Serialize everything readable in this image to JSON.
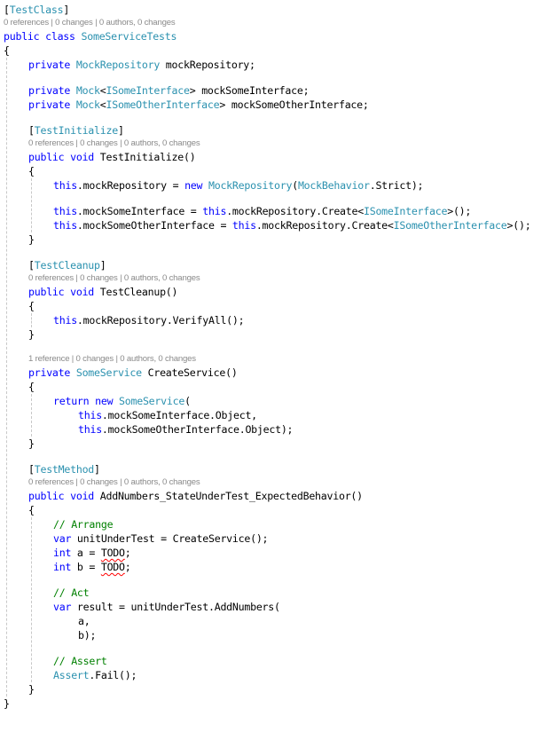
{
  "editor": {
    "lines": [
      {
        "type": "code",
        "indent": 0,
        "tokens": [
          {
            "t": "[",
            "c": ""
          },
          {
            "t": "TestClass",
            "c": "ty"
          },
          {
            "t": "]",
            "c": ""
          }
        ]
      },
      {
        "type": "lens",
        "indent": 0,
        "text": "0 references | 0 changes | 0 authors, 0 changes"
      },
      {
        "type": "code",
        "indent": 0,
        "tokens": [
          {
            "t": "public class ",
            "c": "kw"
          },
          {
            "t": "SomeServiceTests",
            "c": "ty"
          }
        ]
      },
      {
        "type": "code",
        "indent": 0,
        "tokens": [
          {
            "t": "{",
            "c": ""
          }
        ]
      },
      {
        "type": "code",
        "indent": 1,
        "tokens": [
          {
            "t": "private ",
            "c": "kw"
          },
          {
            "t": "MockRepository",
            "c": "ty"
          },
          {
            "t": " mockRepository;",
            "c": ""
          }
        ]
      },
      {
        "type": "blank"
      },
      {
        "type": "code",
        "indent": 1,
        "tokens": [
          {
            "t": "private ",
            "c": "kw"
          },
          {
            "t": "Mock",
            "c": "ty"
          },
          {
            "t": "<",
            "c": ""
          },
          {
            "t": "ISomeInterface",
            "c": "ty"
          },
          {
            "t": "> mockSomeInterface;",
            "c": ""
          }
        ]
      },
      {
        "type": "code",
        "indent": 1,
        "tokens": [
          {
            "t": "private ",
            "c": "kw"
          },
          {
            "t": "Mock",
            "c": "ty"
          },
          {
            "t": "<",
            "c": ""
          },
          {
            "t": "ISomeOtherInterface",
            "c": "ty"
          },
          {
            "t": "> mockSomeOtherInterface;",
            "c": ""
          }
        ]
      },
      {
        "type": "blank"
      },
      {
        "type": "code",
        "indent": 1,
        "tokens": [
          {
            "t": "[",
            "c": ""
          },
          {
            "t": "TestInitialize",
            "c": "ty"
          },
          {
            "t": "]",
            "c": ""
          }
        ]
      },
      {
        "type": "lens",
        "indent": 1,
        "text": "0 references | 0 changes | 0 authors, 0 changes"
      },
      {
        "type": "code",
        "indent": 1,
        "tokens": [
          {
            "t": "public void ",
            "c": "kw"
          },
          {
            "t": "TestInitialize()",
            "c": ""
          }
        ]
      },
      {
        "type": "code",
        "indent": 1,
        "tokens": [
          {
            "t": "{",
            "c": ""
          }
        ]
      },
      {
        "type": "code",
        "indent": 2,
        "tokens": [
          {
            "t": "this",
            "c": "kw"
          },
          {
            "t": ".mockRepository = ",
            "c": ""
          },
          {
            "t": "new ",
            "c": "kw"
          },
          {
            "t": "MockRepository",
            "c": "ty"
          },
          {
            "t": "(",
            "c": ""
          },
          {
            "t": "MockBehavior",
            "c": "ty"
          },
          {
            "t": ".Strict);",
            "c": ""
          }
        ]
      },
      {
        "type": "blank"
      },
      {
        "type": "code",
        "indent": 2,
        "tokens": [
          {
            "t": "this",
            "c": "kw"
          },
          {
            "t": ".mockSomeInterface = ",
            "c": ""
          },
          {
            "t": "this",
            "c": "kw"
          },
          {
            "t": ".mockRepository.Create<",
            "c": ""
          },
          {
            "t": "ISomeInterface",
            "c": "ty"
          },
          {
            "t": ">();",
            "c": ""
          }
        ]
      },
      {
        "type": "code",
        "indent": 2,
        "tokens": [
          {
            "t": "this",
            "c": "kw"
          },
          {
            "t": ".mockSomeOtherInterface = ",
            "c": ""
          },
          {
            "t": "this",
            "c": "kw"
          },
          {
            "t": ".mockRepository.Create<",
            "c": ""
          },
          {
            "t": "ISomeOtherInterface",
            "c": "ty"
          },
          {
            "t": ">();",
            "c": ""
          }
        ]
      },
      {
        "type": "code",
        "indent": 1,
        "tokens": [
          {
            "t": "}",
            "c": ""
          }
        ]
      },
      {
        "type": "blank"
      },
      {
        "type": "code",
        "indent": 1,
        "tokens": [
          {
            "t": "[",
            "c": ""
          },
          {
            "t": "TestCleanup",
            "c": "ty"
          },
          {
            "t": "]",
            "c": ""
          }
        ]
      },
      {
        "type": "lens",
        "indent": 1,
        "text": "0 references | 0 changes | 0 authors, 0 changes"
      },
      {
        "type": "code",
        "indent": 1,
        "tokens": [
          {
            "t": "public void ",
            "c": "kw"
          },
          {
            "t": "TestCleanup()",
            "c": ""
          }
        ]
      },
      {
        "type": "code",
        "indent": 1,
        "tokens": [
          {
            "t": "{",
            "c": ""
          }
        ]
      },
      {
        "type": "code",
        "indent": 2,
        "tokens": [
          {
            "t": "this",
            "c": "kw"
          },
          {
            "t": ".mockRepository.VerifyAll();",
            "c": ""
          }
        ]
      },
      {
        "type": "code",
        "indent": 1,
        "tokens": [
          {
            "t": "}",
            "c": ""
          }
        ]
      },
      {
        "type": "blank"
      },
      {
        "type": "lens",
        "indent": 1,
        "text": "1 reference | 0 changes | 0 authors, 0 changes"
      },
      {
        "type": "code",
        "indent": 1,
        "tokens": [
          {
            "t": "private ",
            "c": "kw"
          },
          {
            "t": "SomeService",
            "c": "ty"
          },
          {
            "t": " CreateService()",
            "c": ""
          }
        ]
      },
      {
        "type": "code",
        "indent": 1,
        "tokens": [
          {
            "t": "{",
            "c": ""
          }
        ]
      },
      {
        "type": "code",
        "indent": 2,
        "tokens": [
          {
            "t": "return new ",
            "c": "kw"
          },
          {
            "t": "SomeService",
            "c": "ty"
          },
          {
            "t": "(",
            "c": ""
          }
        ]
      },
      {
        "type": "code",
        "indent": 3,
        "tokens": [
          {
            "t": "this",
            "c": "kw"
          },
          {
            "t": ".mockSomeInterface.Object,",
            "c": ""
          }
        ]
      },
      {
        "type": "code",
        "indent": 3,
        "tokens": [
          {
            "t": "this",
            "c": "kw"
          },
          {
            "t": ".mockSomeOtherInterface.Object);",
            "c": ""
          }
        ]
      },
      {
        "type": "code",
        "indent": 1,
        "tokens": [
          {
            "t": "}",
            "c": ""
          }
        ]
      },
      {
        "type": "blank"
      },
      {
        "type": "code",
        "indent": 1,
        "tokens": [
          {
            "t": "[",
            "c": ""
          },
          {
            "t": "TestMethod",
            "c": "ty"
          },
          {
            "t": "]",
            "c": ""
          }
        ]
      },
      {
        "type": "lens",
        "indent": 1,
        "text": "0 references | 0 changes | 0 authors, 0 changes"
      },
      {
        "type": "code",
        "indent": 1,
        "tokens": [
          {
            "t": "public void ",
            "c": "kw"
          },
          {
            "t": "AddNumbers_StateUnderTest_ExpectedBehavior()",
            "c": ""
          }
        ]
      },
      {
        "type": "code",
        "indent": 1,
        "tokens": [
          {
            "t": "{",
            "c": ""
          }
        ]
      },
      {
        "type": "code",
        "indent": 2,
        "tokens": [
          {
            "t": "// Arrange",
            "c": "cm"
          }
        ]
      },
      {
        "type": "code",
        "indent": 2,
        "tokens": [
          {
            "t": "var ",
            "c": "kw"
          },
          {
            "t": "unitUnderTest = CreateService();",
            "c": ""
          }
        ]
      },
      {
        "type": "code",
        "indent": 2,
        "tokens": [
          {
            "t": "int ",
            "c": "kw"
          },
          {
            "t": "a = ",
            "c": ""
          },
          {
            "t": "TODO",
            "c": "sq"
          },
          {
            "t": ";",
            "c": ""
          }
        ]
      },
      {
        "type": "code",
        "indent": 2,
        "tokens": [
          {
            "t": "int ",
            "c": "kw"
          },
          {
            "t": "b = ",
            "c": ""
          },
          {
            "t": "TODO",
            "c": "sq"
          },
          {
            "t": ";",
            "c": ""
          }
        ]
      },
      {
        "type": "blank"
      },
      {
        "type": "code",
        "indent": 2,
        "tokens": [
          {
            "t": "// Act",
            "c": "cm"
          }
        ]
      },
      {
        "type": "code",
        "indent": 2,
        "tokens": [
          {
            "t": "var ",
            "c": "kw"
          },
          {
            "t": "result = unitUnderTest.AddNumbers(",
            "c": ""
          }
        ]
      },
      {
        "type": "code",
        "indent": 3,
        "tokens": [
          {
            "t": "a,",
            "c": ""
          }
        ]
      },
      {
        "type": "code",
        "indent": 3,
        "tokens": [
          {
            "t": "b);",
            "c": ""
          }
        ]
      },
      {
        "type": "blank"
      },
      {
        "type": "code",
        "indent": 2,
        "tokens": [
          {
            "t": "// Assert",
            "c": "cm"
          }
        ]
      },
      {
        "type": "code",
        "indent": 2,
        "tokens": [
          {
            "t": "Assert",
            "c": "ty"
          },
          {
            "t": ".Fail();",
            "c": ""
          }
        ]
      },
      {
        "type": "code",
        "indent": 1,
        "tokens": [
          {
            "t": "}",
            "c": ""
          }
        ]
      },
      {
        "type": "code",
        "indent": 0,
        "tokens": [
          {
            "t": "}",
            "c": ""
          }
        ]
      }
    ]
  },
  "colors": {
    "keyword": "#0000ff",
    "type": "#2b91af",
    "comment": "#008000",
    "text": "#000000",
    "codelens": "#8a8a8a",
    "squiggle": "#ff0000"
  }
}
